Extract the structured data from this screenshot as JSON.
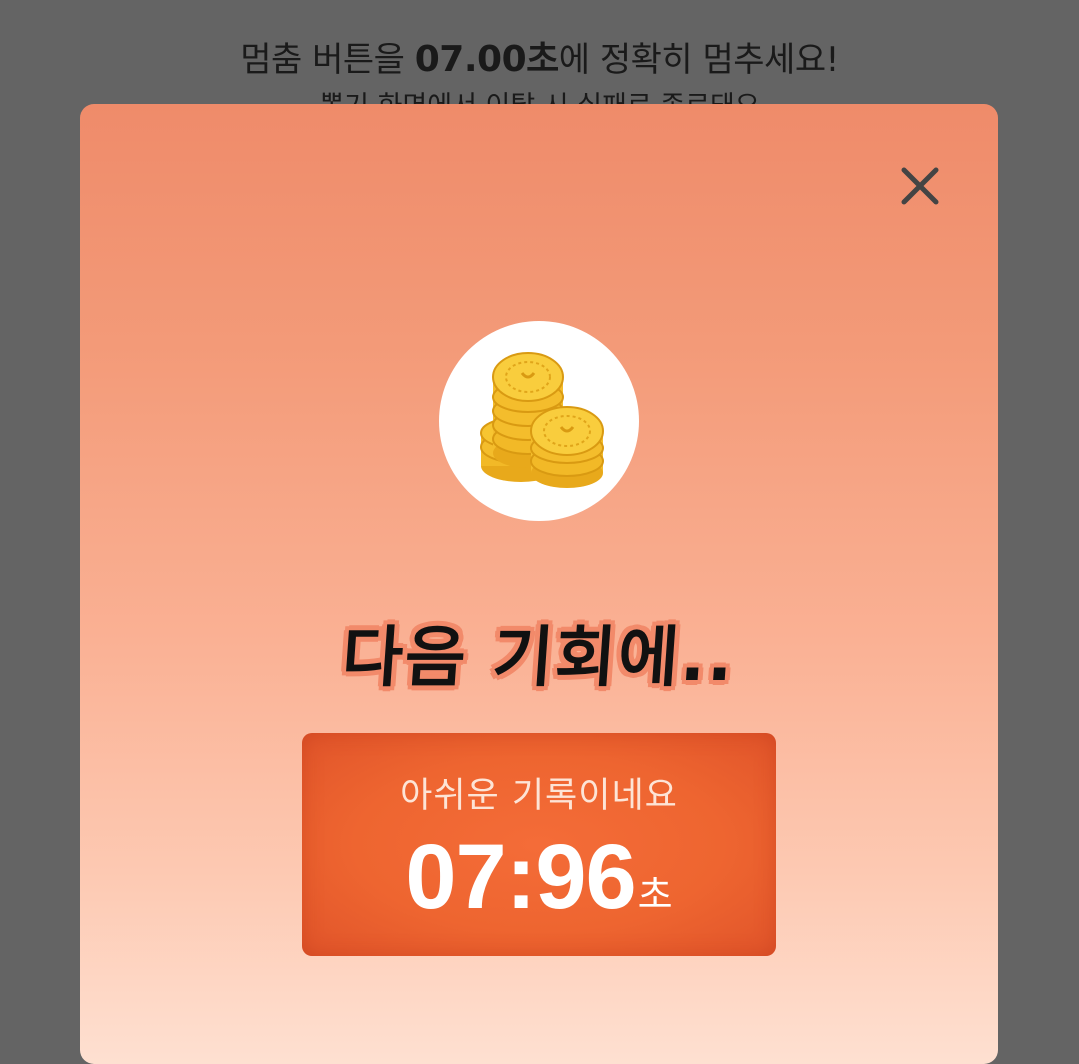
{
  "background": {
    "instruction_prefix": "멈춤 버튼을 ",
    "target_time": "07.00초",
    "instruction_suffix": "에 정확히 멈추세요!",
    "warning": "뽑기 화면에서 이탈 시 실패로 종료돼요"
  },
  "modal": {
    "close_icon": "close-icon",
    "coin_icon": "coin-stack-icon",
    "title": "다음 기회에..",
    "record_message": "아쉬운 기록이네요",
    "record_time": "07:96",
    "record_unit": "초"
  },
  "colors": {
    "overlay": "#646464",
    "modal_top": "#ef8b6a",
    "modal_bottom": "#fee0d1",
    "record_box": "#ee6530",
    "coin": "#f7c531"
  }
}
